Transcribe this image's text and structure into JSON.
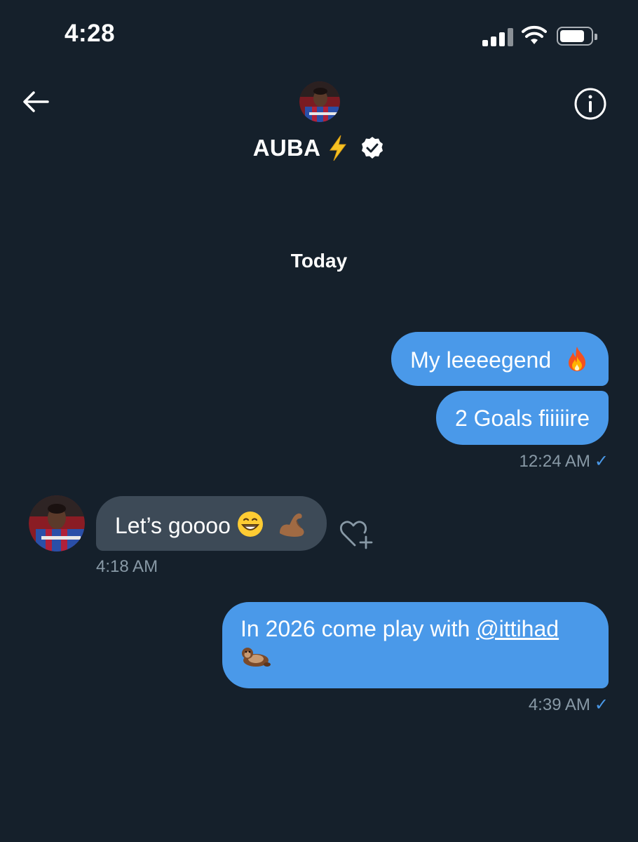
{
  "status_bar": {
    "time": "4:28"
  },
  "header": {
    "contact_name": "AUBA",
    "icons": [
      "back-arrow-icon",
      "info-icon",
      "lightning-icon",
      "verified-badge-icon"
    ]
  },
  "conversation": {
    "day_label": "Today",
    "messages": [
      {
        "direction": "outgoing",
        "text": "My leeeegend",
        "emoji": "fire"
      },
      {
        "direction": "outgoing",
        "text": "2 Goals fiiiiire",
        "timestamp": "12:24 AM",
        "status": "✓"
      },
      {
        "direction": "incoming",
        "text": "Let’s goooo",
        "emoji": [
          "grinning-face",
          "flexed-biceps"
        ],
        "timestamp": "4:18 AM"
      },
      {
        "direction": "outgoing",
        "text": "In 2026 come play with ",
        "mention": "@ittihad",
        "emoji": "otter",
        "timestamp": "4:39 AM",
        "status": "✓"
      }
    ]
  },
  "colors": {
    "background": "#15202b",
    "outgoing_bubble": "#4a99e9",
    "incoming_bubble": "#3d4a57",
    "timestamp": "#8899a6"
  }
}
